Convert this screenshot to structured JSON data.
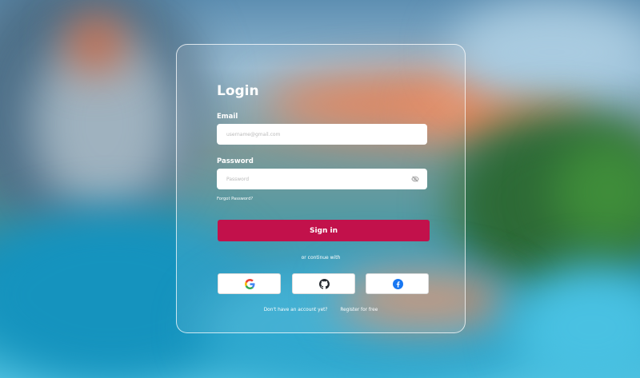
{
  "login": {
    "title": "Login",
    "email": {
      "label": "Email",
      "placeholder": "username@gmail.com",
      "value": ""
    },
    "password": {
      "label": "Password",
      "placeholder": "Password",
      "value": ""
    },
    "forgot_label": "Forgot Password?",
    "sign_in_label": "Sign in",
    "or_continue": "or continue with",
    "social": [
      {
        "icon": "google-icon"
      },
      {
        "icon": "github-icon"
      },
      {
        "icon": "facebook-icon"
      }
    ],
    "footer": {
      "question": "Don't have an account yet?",
      "register_label": "Register for free"
    }
  },
  "colors": {
    "accent": "#c2114b",
    "facebook": "#1877f2",
    "github": "#24292f"
  }
}
